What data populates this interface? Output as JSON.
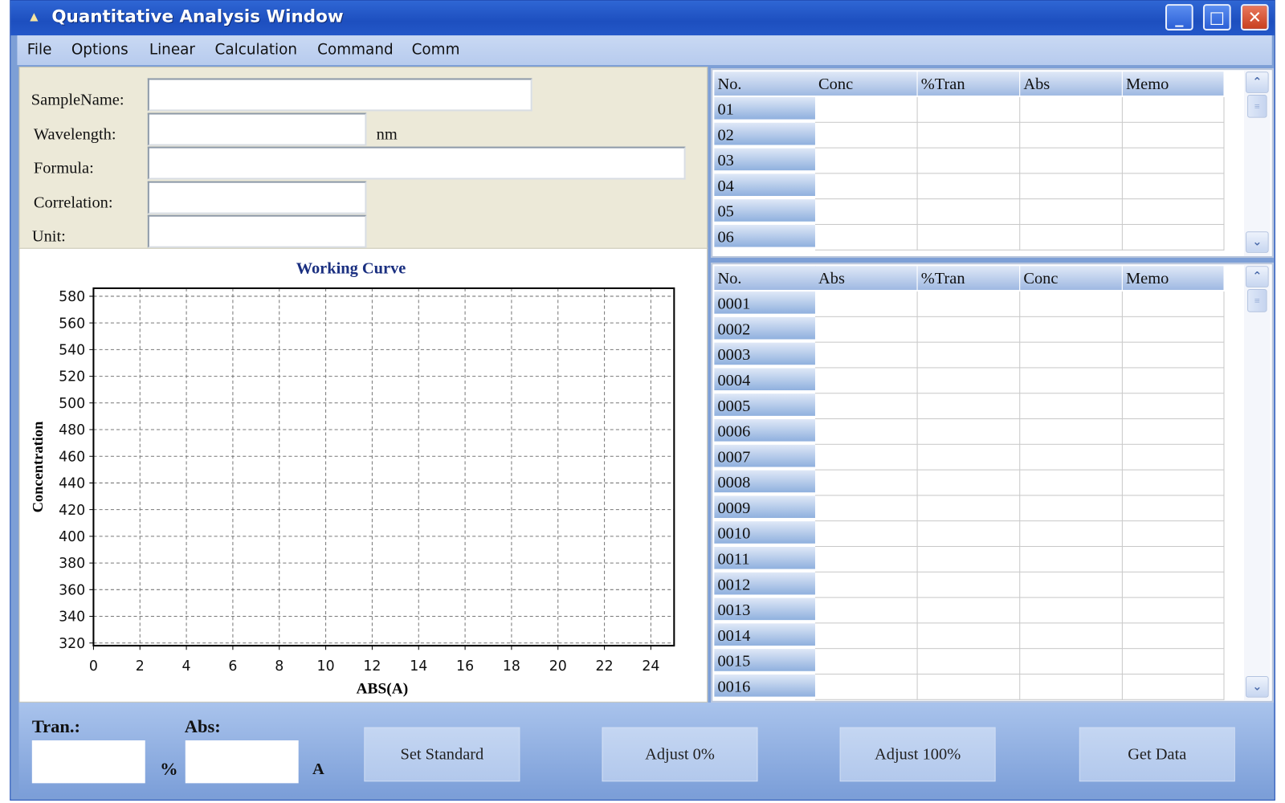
{
  "window": {
    "title": "Quantitative Analysis Window",
    "icon": "home-icon"
  },
  "menu": [
    {
      "label": "File",
      "u": "F",
      "rest": "ile"
    },
    {
      "label": "Options",
      "u": "O",
      "rest": "ptions"
    },
    {
      "label": "Linear",
      "u": "L",
      "rest": "inear"
    },
    {
      "label": "Calculation",
      "pre": "C",
      "u": "a",
      "rest": "lculation"
    },
    {
      "label": "Command",
      "pre": "Co",
      "u": "m",
      "rest": "mand"
    },
    {
      "label": "Comm",
      "u": "C",
      "rest": "omm"
    }
  ],
  "form": {
    "sample_name_label": "SampleName:",
    "sample_name_value": "",
    "wavelength_label": "Wavelength:",
    "wavelength_value": "",
    "wavelength_unit": "nm",
    "formula_label": "Formula:",
    "formula_value": "",
    "correlation_label": "Correlation:",
    "correlation_value": "",
    "unit_label": "Unit:",
    "unit_value": ""
  },
  "chart_data": {
    "type": "scatter",
    "title": "Working Curve",
    "xlabel": "ABS(A)",
    "ylabel": "Concentration",
    "xlim": [
      0,
      25
    ],
    "ylim": [
      318,
      586
    ],
    "xticks": [
      0,
      2,
      4,
      6,
      8,
      10,
      12,
      14,
      16,
      18,
      20,
      22,
      24
    ],
    "yticks": [
      320,
      340,
      360,
      380,
      400,
      420,
      440,
      460,
      480,
      500,
      520,
      540,
      560,
      580
    ],
    "grid": true,
    "grid_style": "dashed",
    "points": [],
    "title_color": "#1a2f80"
  },
  "standard_table": {
    "columns": [
      "No.",
      "Conc",
      "%Tran",
      "Abs",
      "Memo"
    ],
    "rows": [
      "01",
      "02",
      "03",
      "04",
      "05",
      "06"
    ]
  },
  "sample_table": {
    "columns": [
      "No.",
      "Abs",
      "%Tran",
      "Conc",
      "Memo"
    ],
    "rows": [
      "0001",
      "0002",
      "0003",
      "0004",
      "0005",
      "0006",
      "0007",
      "0008",
      "0009",
      "0010",
      "0011",
      "0012",
      "0013",
      "0014",
      "0015",
      "0016"
    ]
  },
  "bottom": {
    "tran_label": "Tran.:",
    "tran_value": "",
    "tran_unit": "%",
    "abs_label": "Abs:",
    "abs_value": "",
    "abs_unit": "A",
    "buttons": [
      "Set Standard",
      "Adjust 0%",
      "Adjust 100%",
      "Get Data"
    ]
  },
  "colors": {
    "titlebar": "#1d4fbf",
    "panel": "#ece9d8",
    "bottom": "#7b9ed8"
  }
}
